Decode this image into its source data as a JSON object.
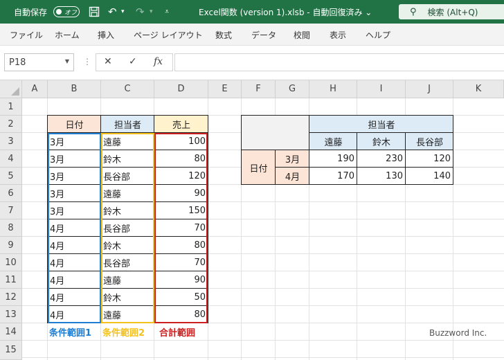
{
  "titlebar": {
    "autosave_label": "自動保存",
    "autosave_state": "オフ",
    "file_title": "Excel関数 (version 1).xlsb  -  自動回復済み  ⌄",
    "search_label": "検索 (Alt+Q)"
  },
  "ribbon": {
    "tabs": [
      "ファイル",
      "ホーム",
      "挿入",
      "ページ レイアウト",
      "数式",
      "データ",
      "校閲",
      "表示",
      "ヘルプ"
    ]
  },
  "formula_bar": {
    "name_box": "P18",
    "formula": ""
  },
  "columns": [
    "A",
    "B",
    "C",
    "D",
    "E",
    "F",
    "G",
    "H",
    "I",
    "J",
    "K"
  ],
  "rows": [
    "1",
    "2",
    "3",
    "4",
    "5",
    "6",
    "7",
    "8",
    "9",
    "10",
    "11",
    "12",
    "13",
    "14",
    "15"
  ],
  "table1": {
    "headers": [
      "日付",
      "担当者",
      "売上"
    ],
    "rows": [
      [
        "3月",
        "遠藤",
        "100"
      ],
      [
        "3月",
        "鈴木",
        "80"
      ],
      [
        "3月",
        "長谷部",
        "120"
      ],
      [
        "3月",
        "遠藤",
        "90"
      ],
      [
        "3月",
        "鈴木",
        "150"
      ],
      [
        "4月",
        "長谷部",
        "70"
      ],
      [
        "4月",
        "鈴木",
        "80"
      ],
      [
        "4月",
        "長谷部",
        "70"
      ],
      [
        "4月",
        "遠藤",
        "90"
      ],
      [
        "4月",
        "鈴木",
        "50"
      ],
      [
        "4月",
        "遠藤",
        "80"
      ]
    ],
    "range_labels": [
      "条件範囲1",
      "条件範囲2",
      "合計範囲"
    ]
  },
  "table2": {
    "col_header": "担当者",
    "row_header": "日付",
    "names": [
      "遠藤",
      "鈴木",
      "長谷部"
    ],
    "months": [
      "3月",
      "4月"
    ],
    "values": [
      [
        "190",
        "230",
        "120"
      ],
      [
        "170",
        "130",
        "140"
      ]
    ]
  },
  "watermark": "Buzzword Inc.",
  "colors": {
    "excel_green": "#217346",
    "header_orange": "#fce4d6",
    "header_blue": "#ddebf7",
    "header_yellow": "#fff2cc",
    "corner_gray": "#f2f2f2",
    "range_blue": "#1f7ed2",
    "range_yellow": "#f5c21b",
    "range_red": "#cc1f1f"
  }
}
